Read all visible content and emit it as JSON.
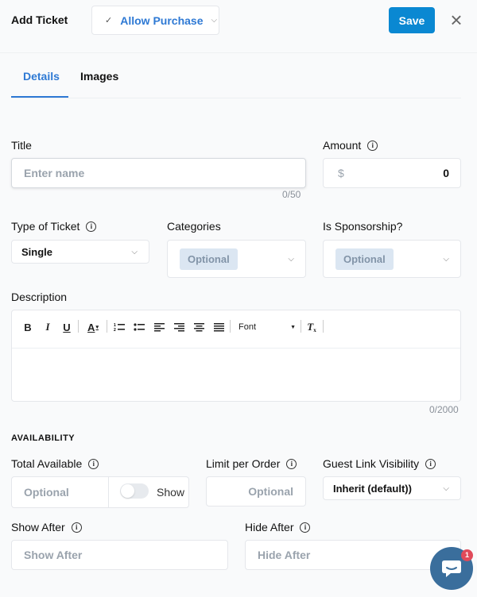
{
  "header": {
    "title": "Add Ticket",
    "status_dropdown": "Allow Purchase",
    "save_label": "Save"
  },
  "tabs": [
    {
      "label": "Details",
      "active": true
    },
    {
      "label": "Images",
      "active": false
    }
  ],
  "fields": {
    "title": {
      "label": "Title",
      "placeholder": "Enter name",
      "counter": "0/50"
    },
    "amount": {
      "label": "Amount",
      "currency": "$",
      "value": "0"
    },
    "type": {
      "label": "Type of Ticket",
      "value": "Single"
    },
    "categories": {
      "label": "Categories",
      "placeholder": "Optional"
    },
    "sponsorship": {
      "label": "Is Sponsorship?",
      "placeholder": "Optional"
    },
    "description": {
      "label": "Description",
      "counter": "0/2000",
      "font_label": "Font"
    }
  },
  "availability": {
    "section_title": "AVAILABILITY",
    "total_available": {
      "label": "Total Available",
      "placeholder": "Optional",
      "toggle_label": "Show",
      "toggle_on": false
    },
    "limit_per_order": {
      "label": "Limit per Order",
      "placeholder": "Optional"
    },
    "guest_link": {
      "label": "Guest Link Visibility",
      "value": "Inherit (default))"
    },
    "show_after": {
      "label": "Show After",
      "placeholder": "Show After"
    },
    "hide_after": {
      "label": "Hide After",
      "placeholder": "Hide After"
    }
  },
  "chat": {
    "badge": "1"
  },
  "colors": {
    "accent": "#2e79d4",
    "save_button": "#0a88d2",
    "chat": "#3a6e9c",
    "badge": "#e04a5a"
  }
}
